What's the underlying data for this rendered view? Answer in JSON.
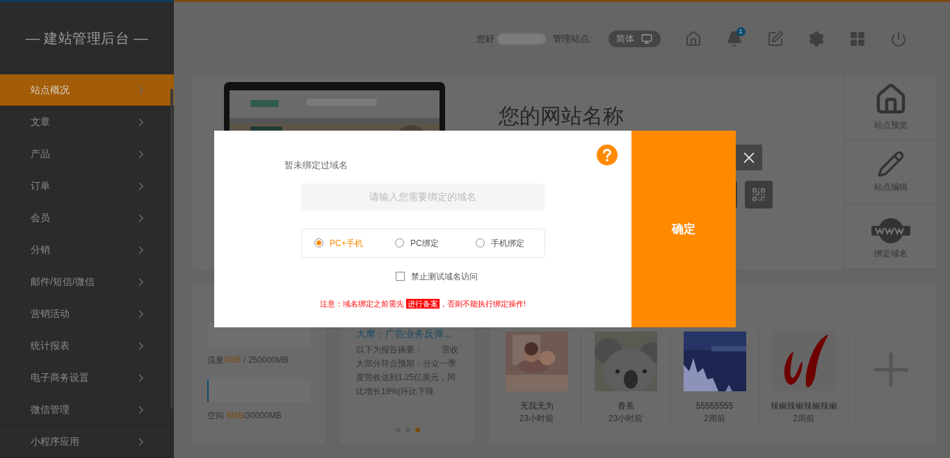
{
  "sidebar": {
    "title": "— 建站管理后台 —",
    "items": [
      {
        "label": "站点概况",
        "selected": true
      },
      {
        "label": "文章",
        "selected": false
      },
      {
        "label": "产品",
        "selected": false
      },
      {
        "label": "订单",
        "selected": false
      },
      {
        "label": "会员",
        "selected": false
      },
      {
        "label": "分销",
        "selected": false
      },
      {
        "label": "邮件/短信/微信",
        "selected": false
      },
      {
        "label": "营销活动",
        "selected": false
      },
      {
        "label": "统计报表",
        "selected": false
      },
      {
        "label": "电子商务设置",
        "selected": false
      },
      {
        "label": "微信管理",
        "selected": false
      },
      {
        "label": "小程序应用",
        "selected": false
      }
    ]
  },
  "header": {
    "greeting": "您好",
    "site_label": "管理站点:",
    "language": "简体",
    "notification_count": "1"
  },
  "site": {
    "name": "您的网站名称",
    "side_actions": [
      {
        "kind": "home",
        "label": "站点预览"
      },
      {
        "kind": "edit",
        "label": "站点编辑"
      },
      {
        "kind": "www",
        "label": "绑定域名"
      }
    ]
  },
  "usage": [
    {
      "label": "流量",
      "value": "0MB",
      "total": " / 250000MB",
      "level": 0
    },
    {
      "label": "空间 ",
      "value": "8MB",
      "total": "/30000MB",
      "level": 0.0003
    }
  ],
  "news": {
    "title": "大摩：广告业务反弹...",
    "body": "以下为报告摘要：        营收大部分符合预期：分众一季度营收达到1.25亿美元，同比增长19%(环比下降",
    "dots": [
      {
        "selected": false
      },
      {
        "selected": false
      },
      {
        "selected": true
      }
    ]
  },
  "gallery": [
    {
      "kind": "kids",
      "title": "无我无为",
      "time": "23小时前"
    },
    {
      "kind": "koala",
      "title": "香蕉",
      "time": "23小时前"
    },
    {
      "kind": "lake",
      "title": "55555555",
      "time": "2周前"
    },
    {
      "kind": "ribbon",
      "title": "辣椒辣椒辣椒辣椒",
      "time": "2周前"
    }
  ],
  "modal": {
    "status": "暂未绑定过域名",
    "placeholder": "请输入您需要绑定的域名",
    "options": [
      {
        "label": "PC+手机",
        "selected": true
      },
      {
        "label": "PC绑定",
        "selected": false
      },
      {
        "label": "手机绑定",
        "selected": false
      }
    ],
    "checkbox": {
      "label": "禁止测试域名访问",
      "checked": false
    },
    "notice": {
      "before": "注意：域名绑定之前需先",
      "highlight": "进行备案",
      "after": "，否则不能执行绑定操作!"
    },
    "confirm": "确定"
  }
}
